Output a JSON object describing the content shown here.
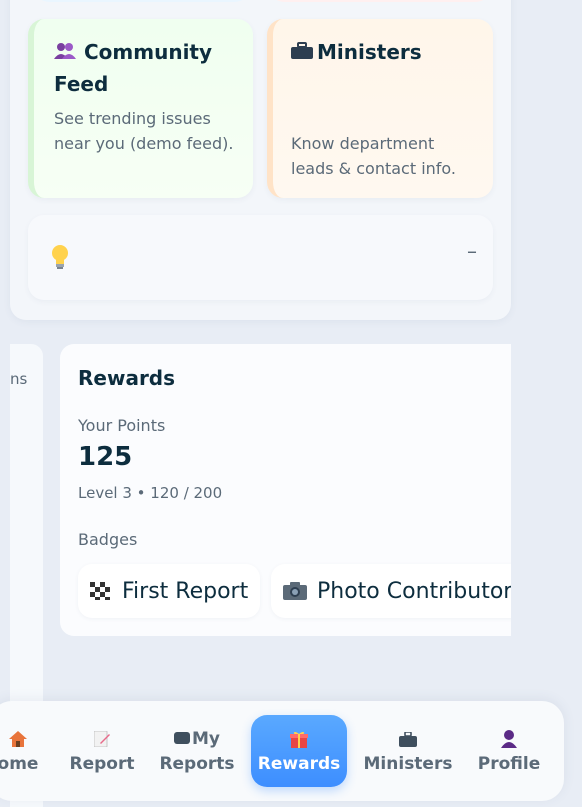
{
  "cards": {
    "community": {
      "title_line1": "Community",
      "title_line2": "Feed",
      "desc": "See trending issues near you (demo feed).",
      "icon": "people-icon"
    },
    "ministers": {
      "title": "Ministers",
      "desc": "Know department leads & contact info.",
      "icon": "briefcase-icon"
    }
  },
  "tip": {
    "icon": "lightbulb-icon",
    "collapse": "–"
  },
  "left_strip": {
    "text": "ns"
  },
  "rewards": {
    "title": "Rewards",
    "points_label": "Your Points",
    "points_value": "125",
    "level_text": "Level 3 • 120 / 200",
    "progress": {
      "current": 120,
      "max": 200
    },
    "badges_label": "Badges",
    "badges": [
      {
        "label": "First Report",
        "icon": "checkered-flag-icon"
      },
      {
        "label": "Photo Contributor",
        "icon": "camera-icon"
      }
    ]
  },
  "tabbar": {
    "tabs": [
      {
        "label": "ome",
        "icon": "home-icon"
      },
      {
        "label": "Report",
        "icon": "memo-icon"
      },
      {
        "label": "My",
        "label_line2": "Reports",
        "icon": "tag-icon"
      },
      {
        "label": "Rewards",
        "icon": "gift-icon",
        "active": true
      },
      {
        "label": "Ministers",
        "icon": "briefcase-icon"
      },
      {
        "label": "Profile",
        "icon": "person-icon"
      }
    ],
    "active_color": "#3d8eff"
  }
}
